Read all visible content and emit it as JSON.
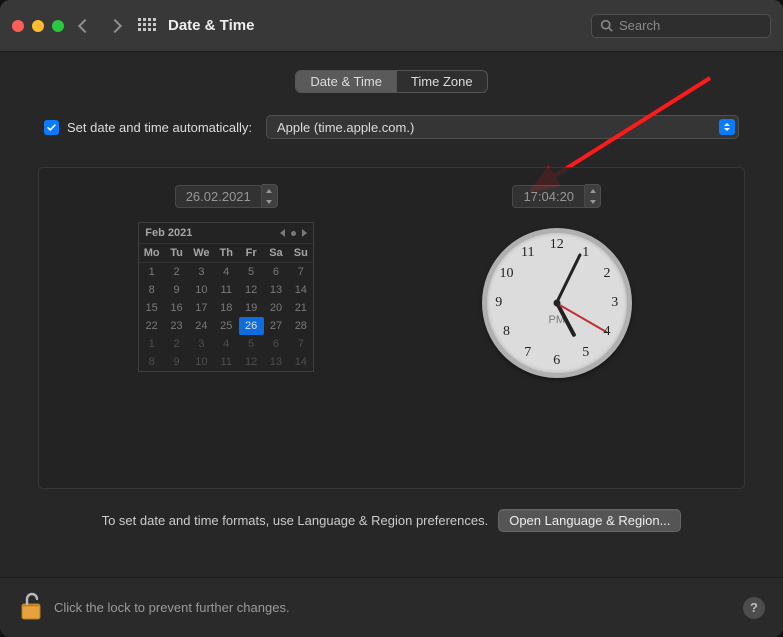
{
  "window": {
    "title": "Date & Time"
  },
  "search": {
    "placeholder": "Search"
  },
  "tabs": {
    "date_time": "Date & Time",
    "time_zone": "Time Zone"
  },
  "auto": {
    "label": "Set date and time automatically:",
    "server": "Apple (time.apple.com.)"
  },
  "date_field": "26.02.2021",
  "time_field": "17:04:20",
  "calendar": {
    "month_label": "Feb 2021",
    "weekdays": [
      "Mo",
      "Tu",
      "We",
      "Th",
      "Fr",
      "Sa",
      "Su"
    ],
    "cells": [
      {
        "n": "1"
      },
      {
        "n": "2"
      },
      {
        "n": "3"
      },
      {
        "n": "4"
      },
      {
        "n": "5"
      },
      {
        "n": "6"
      },
      {
        "n": "7"
      },
      {
        "n": "8"
      },
      {
        "n": "9"
      },
      {
        "n": "10"
      },
      {
        "n": "11"
      },
      {
        "n": "12"
      },
      {
        "n": "13"
      },
      {
        "n": "14"
      },
      {
        "n": "15"
      },
      {
        "n": "16"
      },
      {
        "n": "17"
      },
      {
        "n": "18"
      },
      {
        "n": "19"
      },
      {
        "n": "20"
      },
      {
        "n": "21"
      },
      {
        "n": "22"
      },
      {
        "n": "23"
      },
      {
        "n": "24"
      },
      {
        "n": "25"
      },
      {
        "n": "26",
        "sel": true
      },
      {
        "n": "27"
      },
      {
        "n": "28"
      },
      {
        "n": "1",
        "dim": true
      },
      {
        "n": "2",
        "dim": true
      },
      {
        "n": "3",
        "dim": true
      },
      {
        "n": "4",
        "dim": true
      },
      {
        "n": "5",
        "dim": true
      },
      {
        "n": "6",
        "dim": true
      },
      {
        "n": "7",
        "dim": true
      },
      {
        "n": "8",
        "dim": true
      },
      {
        "n": "9",
        "dim": true
      },
      {
        "n": "10",
        "dim": true
      },
      {
        "n": "11",
        "dim": true
      },
      {
        "n": "12",
        "dim": true
      },
      {
        "n": "13",
        "dim": true
      },
      {
        "n": "14",
        "dim": true
      }
    ]
  },
  "clock": {
    "ampm": "PM",
    "hour_angle": 152,
    "minute_angle": 26,
    "second_angle": 120,
    "numerals": [
      "12",
      "1",
      "2",
      "3",
      "4",
      "5",
      "6",
      "7",
      "8",
      "9",
      "10",
      "11"
    ]
  },
  "format_hint": "To set date and time formats, use Language & Region preferences.",
  "open_lang_button": "Open Language & Region...",
  "lock_hint": "Click the lock to prevent further changes.",
  "help": "?"
}
